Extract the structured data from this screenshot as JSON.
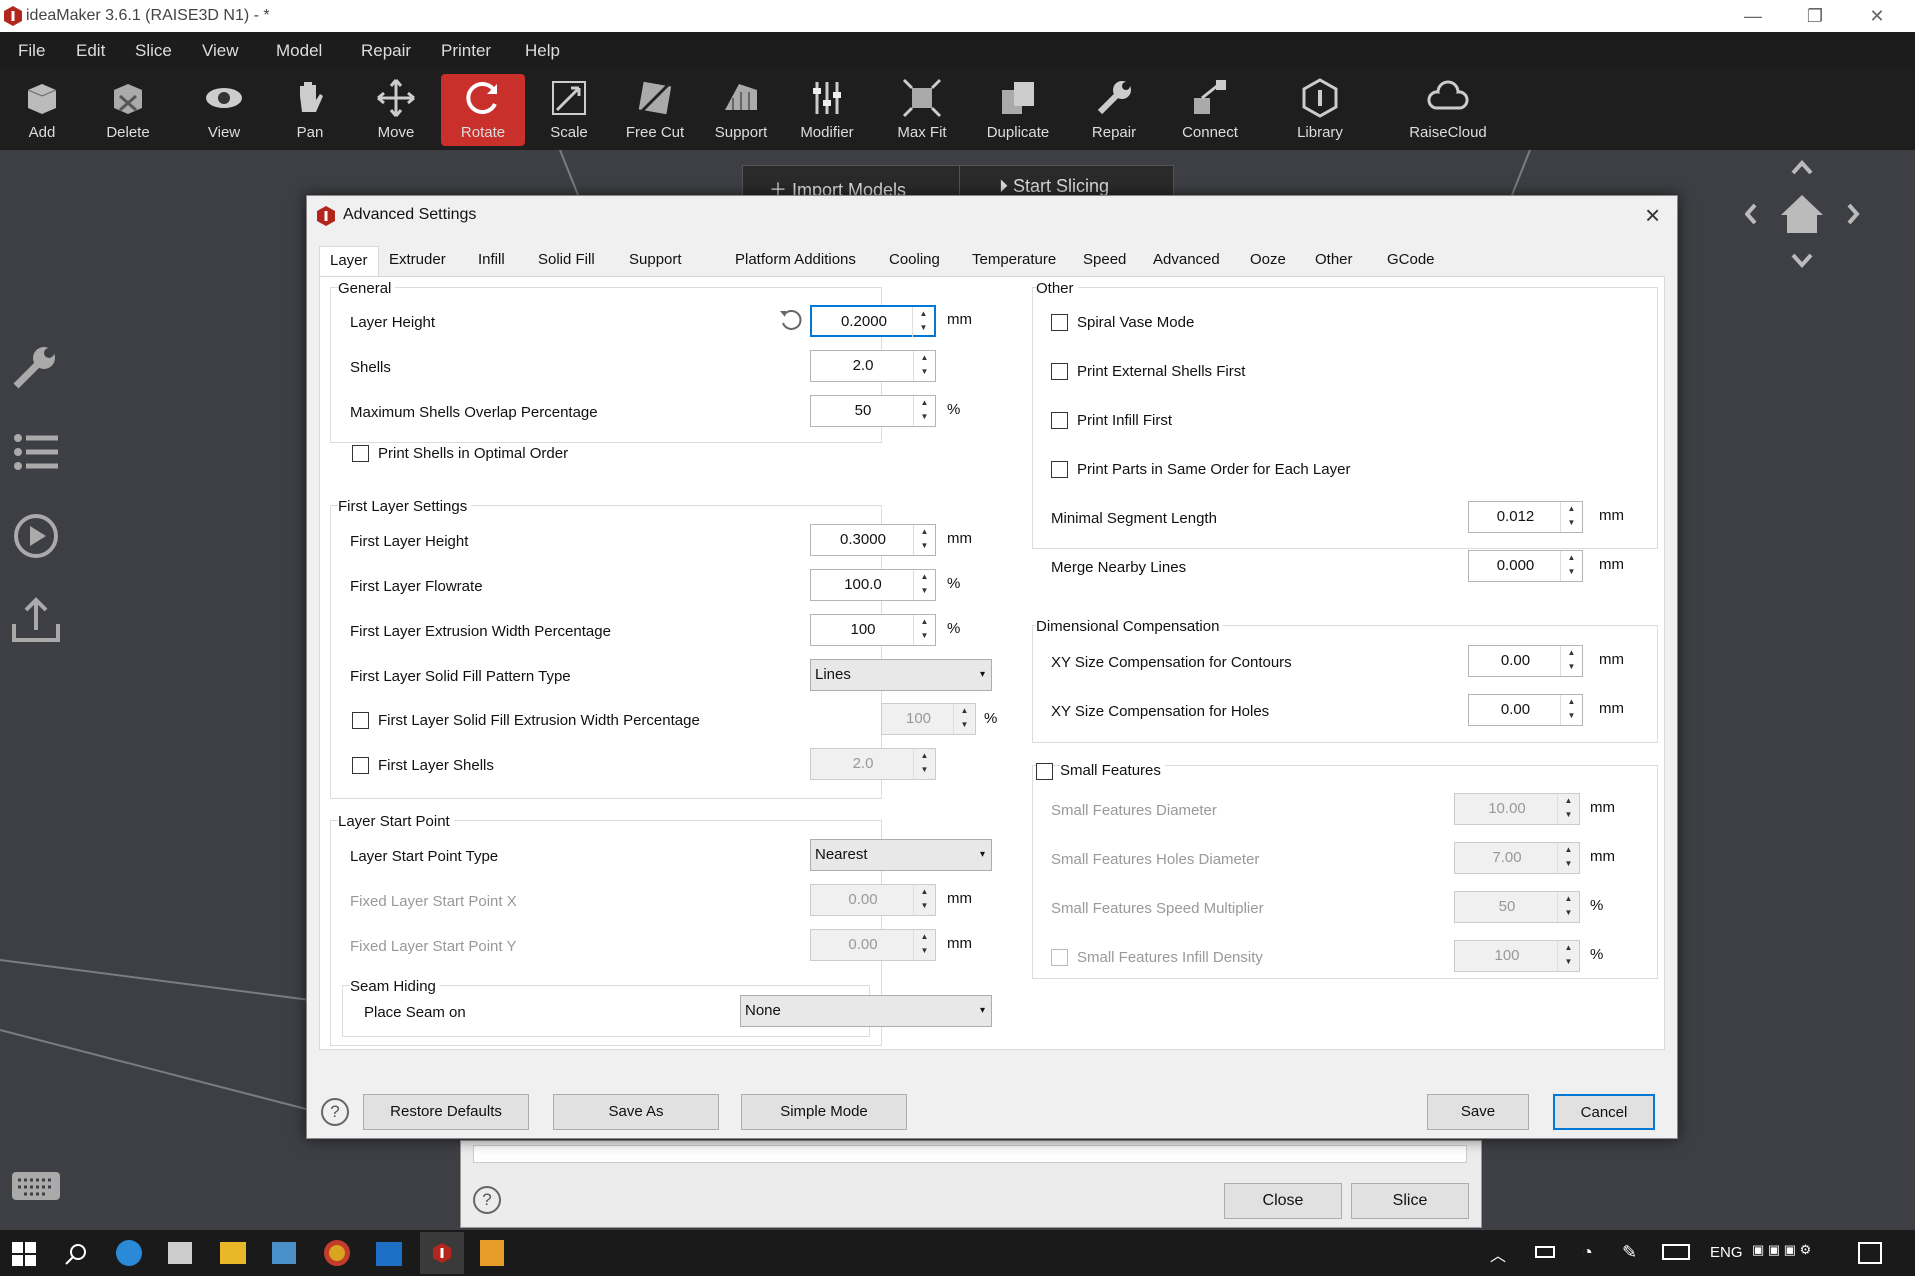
{
  "app": {
    "title": "ideaMaker 3.6.1 (RAISE3D N1) - *"
  },
  "window_controls": [
    "—",
    "❐",
    "✕"
  ],
  "menu": [
    "File",
    "Edit",
    "Slice",
    "View",
    "Model",
    "Repair",
    "Printer",
    "Help"
  ],
  "toolbar": [
    "Add",
    "Delete",
    "View",
    "Pan",
    "Move",
    "Rotate",
    "Scale",
    "Free Cut",
    "Support",
    "Modifier",
    "Max Fit",
    "Duplicate",
    "Repair",
    "Connect",
    "Library",
    "RaiseCloud"
  ],
  "toolbar_active": "Rotate",
  "accent": "#c9302c",
  "top_actions": {
    "import": "Import Models",
    "slice": "Start Slicing"
  },
  "bottom_panel": {
    "close": "Close",
    "slice": "Slice"
  },
  "dialog": {
    "title": "Advanced Settings",
    "tabs": [
      "Layer",
      "Extruder",
      "Infill",
      "Solid Fill",
      "Support",
      "Platform Additions",
      "Cooling",
      "Temperature",
      "Speed",
      "Advanced",
      "Ooze",
      "Other",
      "GCode"
    ],
    "general": {
      "title": "General",
      "layer_height": {
        "label": "Layer Height",
        "value": "0.2000",
        "unit": "mm"
      },
      "shells": {
        "label": "Shells",
        "value": "2.0"
      },
      "max_overlap": {
        "label": "Maximum Shells Overlap Percentage",
        "value": "50",
        "unit": "%"
      },
      "optimal_order": {
        "label": "Print Shells in Optimal Order",
        "checked": false
      }
    },
    "first_layer": {
      "title": "First Layer Settings",
      "height": {
        "label": "First Layer Height",
        "value": "0.3000",
        "unit": "mm"
      },
      "flowrate": {
        "label": "First Layer Flowrate",
        "value": "100.0",
        "unit": "%"
      },
      "ext_width": {
        "label": "First Layer Extrusion Width Percentage",
        "value": "100",
        "unit": "%"
      },
      "pattern": {
        "label": "First Layer Solid Fill Pattern Type",
        "value": "Lines"
      },
      "solid_width": {
        "label": "First Layer Solid Fill Extrusion Width Percentage",
        "value": "100",
        "unit": "%",
        "checked": false
      },
      "shells": {
        "label": "First Layer Shells",
        "value": "2.0",
        "checked": false
      }
    },
    "start_point": {
      "title": "Layer Start Point",
      "type": {
        "label": "Layer Start Point Type",
        "value": "Nearest"
      },
      "x": {
        "label": "Fixed Layer Start Point X",
        "value": "0.00",
        "unit": "mm"
      },
      "y": {
        "label": "Fixed Layer Start Point Y",
        "value": "0.00",
        "unit": "mm"
      },
      "seam": {
        "title": "Seam Hiding",
        "label": "Place Seam on",
        "value": "None"
      }
    },
    "other": {
      "title": "Other",
      "spiral": "Spiral Vase Mode",
      "ext_first": "Print External Shells First",
      "infill_first": "Print Infill First",
      "same_order": "Print Parts in Same Order for Each Layer",
      "min_seg": {
        "label": "Minimal Segment Length",
        "value": "0.012",
        "unit": "mm"
      },
      "merge": {
        "label": "Merge Nearby Lines",
        "value": "0.000",
        "unit": "mm"
      }
    },
    "dimensional": {
      "title": "Dimensional Compensation",
      "xy_contours": {
        "label": "XY Size Compensation for Contours",
        "value": "0.00",
        "unit": "mm"
      },
      "xy_holes": {
        "label": "XY Size Compensation for Holes",
        "value": "0.00",
        "unit": "mm"
      }
    },
    "small": {
      "title": "Small Features",
      "diameter": {
        "label": "Small Features Diameter",
        "value": "10.00",
        "unit": "mm"
      },
      "holes": {
        "label": "Small Features Holes Diameter",
        "value": "7.00",
        "unit": "mm"
      },
      "speed": {
        "label": "Small Features Speed Multiplier",
        "value": "50",
        "unit": "%"
      },
      "infill": {
        "label": "Small Features Infill Density",
        "value": "100",
        "unit": "%"
      }
    },
    "buttons": {
      "help": "?",
      "restore": "Restore Defaults",
      "save_as": "Save As",
      "simple": "Simple Mode",
      "save": "Save",
      "cancel": "Cancel"
    }
  },
  "taskbar": {
    "lang": "ENG"
  }
}
